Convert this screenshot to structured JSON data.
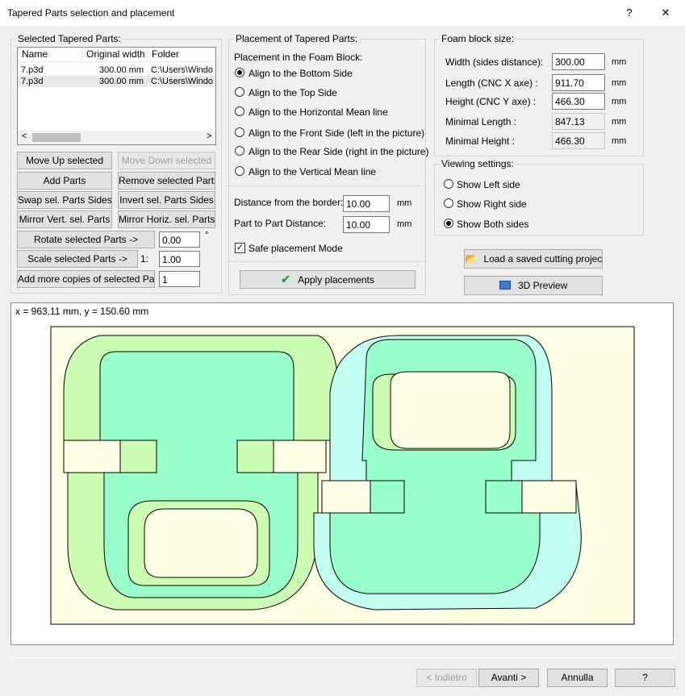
{
  "window": {
    "title": "Tapered Parts selection and placement",
    "help_glyph": "?",
    "close_glyph": "✕"
  },
  "selected_parts": {
    "group_label": "Selected Tapered Parts:",
    "columns": [
      "Name",
      "Original width",
      "Folder"
    ],
    "rows": [
      {
        "name": "7.p3d",
        "width": "300.00 mm",
        "folder": "C:\\Users\\Windo"
      },
      {
        "name": "7.p3d",
        "width": "300.00 mm",
        "folder": "C:\\Users\\Windo"
      }
    ],
    "scroll_left": "<",
    "scroll_right": ">",
    "buttons": {
      "move_up": "Move Up selected",
      "move_down": "Move Down selected",
      "add_parts": "Add Parts",
      "remove_parts": "Remove selected Parts",
      "swap_sides": "Swap sel. Parts Sides",
      "invert_sides": "Invert sel. Parts Sides",
      "mirror_vert": "Mirror Vert. sel. Parts",
      "mirror_horiz": "Mirror Horiz. sel. Parts",
      "rotate": "Rotate selected Parts ->",
      "scale": "Scale selected Parts ->",
      "add_copies": "Add more copies of selected Parts:"
    },
    "rotate_value": "0.00",
    "rotate_unit": "°",
    "scale_prefix": "1:",
    "scale_value": "1.00",
    "copies_value": "1"
  },
  "placement": {
    "group_label": "Placement of Tapered Parts:",
    "subtitle": "Placement in the Foam Block:",
    "options": [
      "Align to the Bottom Side",
      "Align to the Top Side",
      "Align to the Horizontal Mean line",
      "Align to the Front Side (left in the picture)",
      "Align to the Rear Side (right in the picture)",
      "Align to the Vertical Mean line"
    ],
    "selected_index": 0,
    "border_label": "Distance from the border:",
    "border_value": "10.00",
    "part_label": "Part to Part Distance:",
    "part_value": "10.00",
    "unit": "mm",
    "safe_label": "Safe placement Mode",
    "safe_checked": true,
    "apply_label": "Apply placements"
  },
  "foam_block": {
    "group_label": "Foam block size:",
    "fields": [
      {
        "label": "Width (sides distance):",
        "value": "300.00",
        "unit": "mm"
      },
      {
        "label": "Length (CNC X axe) :",
        "value": "911.70",
        "unit": "mm"
      },
      {
        "label": "Height (CNC Y axe) :",
        "value": "466.30",
        "unit": "mm"
      },
      {
        "label": "Minimal Length :",
        "value": "847.13",
        "unit": "mm"
      },
      {
        "label": "Minimal Height :",
        "value": "466.30",
        "unit": "mm"
      }
    ]
  },
  "viewing": {
    "group_label": "Viewing settings:",
    "options": [
      "Show Left side",
      "Show Right side",
      "Show Both sides"
    ],
    "selected_index": 2
  },
  "load_project_label": "Load a saved cutting project",
  "preview_label": "3D Preview",
  "canvas": {
    "coords": "x = 963.11 mm, y = 150.60 mm",
    "colors": {
      "block": "#ffffe6",
      "green": "#ccffb3",
      "cyan": "#c2fff0",
      "mix": "#99ffcc"
    }
  },
  "footer": {
    "back": "< Indietro",
    "next": "Avanti >",
    "cancel": "Annulla",
    "help": "?"
  }
}
